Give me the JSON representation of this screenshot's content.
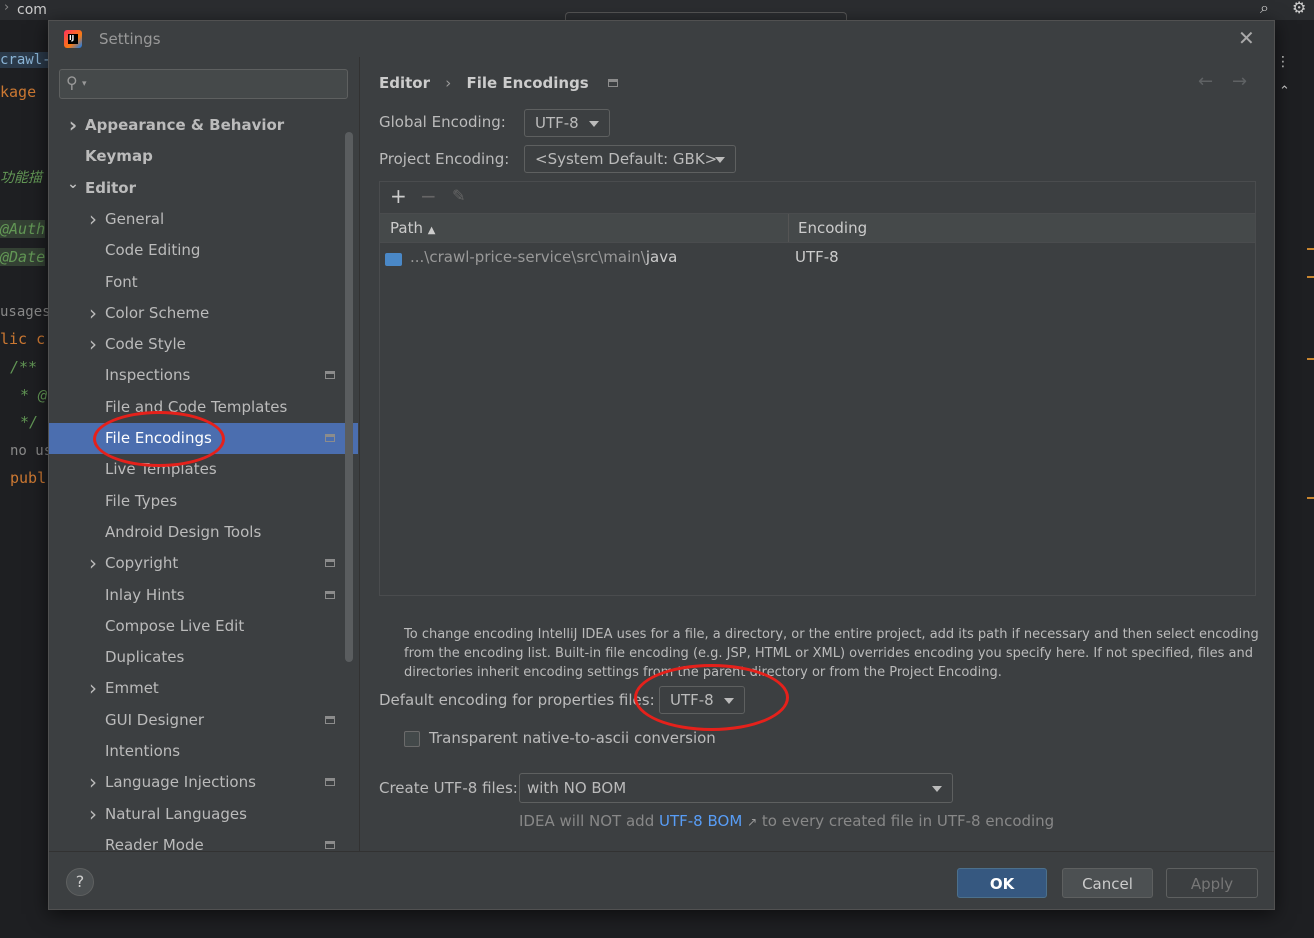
{
  "ide": {
    "top_text": "com",
    "left_lines": [
      "crawl-p",
      "kage",
      "功能描",
      "@Auth",
      "@Date",
      "usages",
      "lic c",
      "/**",
      "* @",
      "*/",
      "no us",
      "publ"
    ]
  },
  "dialog": {
    "title": "Settings",
    "search_placeholder": "",
    "sidebar": {
      "items": [
        {
          "label": "Appearance & Behavior",
          "chevron": "right",
          "level": 0,
          "bold": true
        },
        {
          "label": "Keymap",
          "chevron": "",
          "level": 0,
          "bold": true
        },
        {
          "label": "Editor",
          "chevron": "down",
          "level": 0,
          "bold": true
        },
        {
          "label": "General",
          "chevron": "right",
          "level": 1
        },
        {
          "label": "Code Editing",
          "chevron": "",
          "level": 1
        },
        {
          "label": "Font",
          "chevron": "",
          "level": 1
        },
        {
          "label": "Color Scheme",
          "chevron": "right",
          "level": 1
        },
        {
          "label": "Code Style",
          "chevron": "right",
          "level": 1
        },
        {
          "label": "Inspections",
          "chevron": "",
          "level": 1,
          "project_icon": true
        },
        {
          "label": "File and Code Templates",
          "chevron": "",
          "level": 1
        },
        {
          "label": "File Encodings",
          "chevron": "",
          "level": 1,
          "project_icon": true,
          "selected": true
        },
        {
          "label": "Live Templates",
          "chevron": "",
          "level": 1
        },
        {
          "label": "File Types",
          "chevron": "",
          "level": 1
        },
        {
          "label": "Android Design Tools",
          "chevron": "",
          "level": 1
        },
        {
          "label": "Copyright",
          "chevron": "right",
          "level": 1,
          "project_icon": true
        },
        {
          "label": "Inlay Hints",
          "chevron": "",
          "level": 1,
          "project_icon": true
        },
        {
          "label": "Compose Live Edit",
          "chevron": "",
          "level": 1
        },
        {
          "label": "Duplicates",
          "chevron": "",
          "level": 1
        },
        {
          "label": "Emmet",
          "chevron": "right",
          "level": 1
        },
        {
          "label": "GUI Designer",
          "chevron": "",
          "level": 1,
          "project_icon": true
        },
        {
          "label": "Intentions",
          "chevron": "",
          "level": 1
        },
        {
          "label": "Language Injections",
          "chevron": "right",
          "level": 1,
          "project_icon": true
        },
        {
          "label": "Natural Languages",
          "chevron": "right",
          "level": 1
        },
        {
          "label": "Reader Mode",
          "chevron": "",
          "level": 1,
          "project_icon": true
        }
      ]
    },
    "breadcrumb": {
      "parent": "Editor",
      "separator": "›",
      "current": "File Encodings"
    },
    "global_encoding": {
      "label": "Global Encoding:",
      "value": "UTF-8"
    },
    "project_encoding": {
      "label": "Project Encoding:",
      "value": "<System Default: GBK>"
    },
    "table": {
      "headers": {
        "path": "Path",
        "encoding": "Encoding"
      },
      "rows": [
        {
          "path_prefix": "...\\crawl-price-service\\src\\main\\",
          "path_name": "java",
          "encoding": "UTF-8"
        }
      ]
    },
    "help_text": "To change encoding IntelliJ IDEA uses for a file, a directory, or the entire project, add its path if necessary and then select encoding from the encoding list. Built-in file encoding (e.g. JSP, HTML or XML) overrides encoding you specify here. If not specified, files and directories inherit encoding settings from the parent directory or from the Project Encoding.",
    "properties": {
      "label": "Default encoding for properties files:",
      "value": "UTF-8"
    },
    "native_to_ascii": {
      "label": "Transparent native-to-ascii conversion",
      "checked": false
    },
    "create_utf8": {
      "label": "Create UTF-8 files:",
      "value": "with NO BOM"
    },
    "bom_note": {
      "prefix": "IDEA will NOT add",
      "link": "UTF-8 BOM",
      "link_arrow": "↗",
      "suffix": "to every created file in UTF-8 encoding"
    },
    "buttons": {
      "ok": "OK",
      "cancel": "Cancel",
      "apply": "Apply",
      "help": "?"
    }
  },
  "colors": {
    "accent": "#4b6eaf",
    "ok_button": "#365880",
    "link": "#589df6",
    "annotation": "#e5211b"
  }
}
